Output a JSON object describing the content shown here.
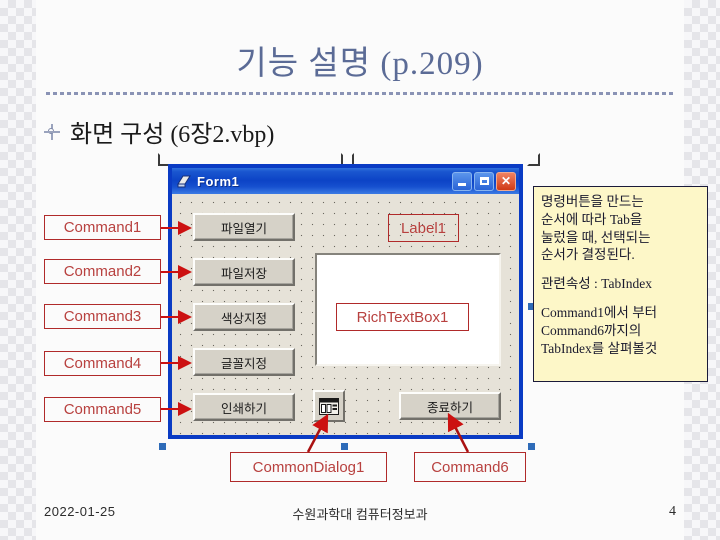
{
  "slide": {
    "title": "기능 설명 (p.209)",
    "bullet": "화면 구성 (6장2.vbp)"
  },
  "form_window": {
    "title": "Form1",
    "icon": "vb-form-icon",
    "buttons": {
      "minimize": "minimize-icon",
      "maximize": "maximize-icon",
      "close": "✕"
    },
    "controls": [
      {
        "name": "btn-open-file",
        "label": "파일열기"
      },
      {
        "name": "btn-save-file",
        "label": "파일저장"
      },
      {
        "name": "btn-color",
        "label": "색상지정"
      },
      {
        "name": "btn-font",
        "label": "글꼴지정"
      },
      {
        "name": "btn-print",
        "label": "인쇄하기"
      },
      {
        "name": "btn-exit",
        "label": "종료하기"
      }
    ]
  },
  "annotations": {
    "left": [
      "Command1",
      "Command2",
      "Command3",
      "Command4",
      "Command5"
    ],
    "label1": "Label1",
    "richtextbox": "RichTextBox1",
    "commondialog": "CommonDialog1",
    "command6": "Command6"
  },
  "note": {
    "line1": "명령버튼을 만드는",
    "line2": "순서에 따라 Tab을",
    "line3": "눌렀을 때, 선택되는",
    "line4": "순서가 결정된다.",
    "line5": "관련속성 : TabIndex",
    "line6": "Command1에서 부터",
    "line7": "Command6까지의",
    "line8": "TabIndex를 살펴볼것"
  },
  "footer": {
    "date": "2022-01-25",
    "center": "수원과학대 컴퓨터정보과",
    "page": "4"
  },
  "colors": {
    "title": "#5b6b96",
    "annotation": "#b8413f",
    "form_border": "#0a3bc4",
    "note_bg": "#fdf7c8",
    "titlebar": "#0c43c6"
  }
}
